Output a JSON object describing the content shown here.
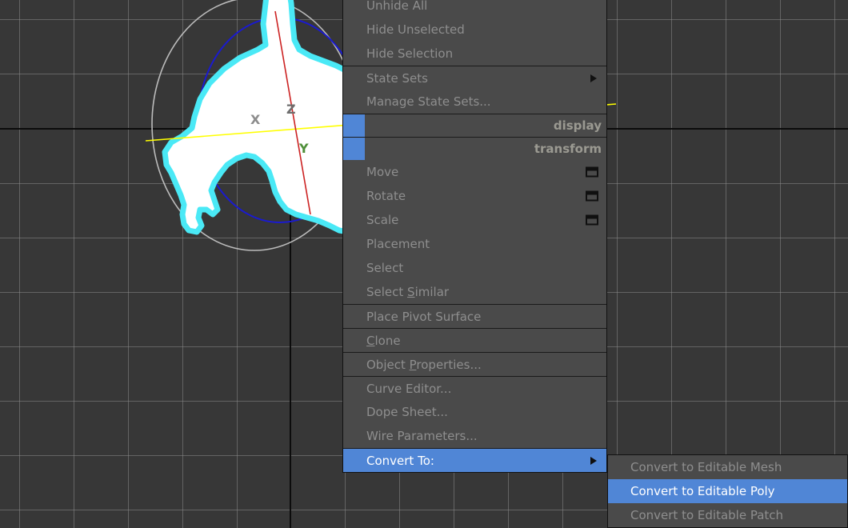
{
  "viewport": {
    "background_color": "#373737",
    "grid_color": "#8a8a8a",
    "axis_color": "#0a0a0a",
    "object": {
      "name": "selected-mesh",
      "fill_color": "#ffffff",
      "outline_color": "#45e8f5"
    },
    "gizmo": {
      "type": "rotate-gizmo",
      "outer_circle_color": "#b9b9b9",
      "inner_circle_color": "#1414c8",
      "axes": [
        {
          "label": "X",
          "color": "#ffff00",
          "label_color": "#8c8c8c"
        },
        {
          "label": "Y",
          "color": "#cc2222",
          "label_color": "#4f8f3a"
        },
        {
          "label": "Z",
          "color": "#cc2222",
          "label_color": "#6a6a6a"
        }
      ]
    }
  },
  "quad_menu": {
    "accent_color": "#5086d6",
    "background_color": "#4a4a4a",
    "text_color": "#8e8e8e",
    "items": [
      {
        "label": "Unhide All",
        "separator": false,
        "arrow": false,
        "settings": false,
        "highlight": false
      },
      {
        "label": "Hide Unselected",
        "separator": false,
        "arrow": false,
        "settings": false,
        "highlight": false
      },
      {
        "label": "Hide Selection",
        "separator": false,
        "arrow": false,
        "settings": false,
        "highlight": false
      },
      {
        "label": "State Sets",
        "separator": true,
        "arrow": true,
        "settings": false,
        "highlight": false
      },
      {
        "label": "Manage State Sets...",
        "separator": false,
        "arrow": false,
        "settings": false,
        "highlight": false
      }
    ],
    "headers": [
      {
        "label": "display"
      },
      {
        "label": "transform"
      }
    ],
    "items2": [
      {
        "label": "Move",
        "separator": false,
        "arrow": false,
        "settings": true,
        "highlight": false
      },
      {
        "label": "Rotate",
        "separator": false,
        "arrow": false,
        "settings": true,
        "highlight": false
      },
      {
        "label": "Scale",
        "separator": false,
        "arrow": false,
        "settings": true,
        "highlight": false
      },
      {
        "label": "Placement",
        "separator": false,
        "arrow": false,
        "settings": false,
        "highlight": false
      },
      {
        "label": "Select",
        "separator": false,
        "arrow": false,
        "settings": false,
        "highlight": false
      },
      {
        "label": "Select Similar",
        "separator": false,
        "arrow": false,
        "settings": false,
        "highlight": false,
        "accel": "S",
        "accel_index": 7
      },
      {
        "label": "Place Pivot Surface",
        "separator": true,
        "arrow": false,
        "settings": false,
        "highlight": false
      },
      {
        "label": "Clone",
        "separator": true,
        "arrow": false,
        "settings": false,
        "highlight": false,
        "accel": "C",
        "accel_index": 0
      },
      {
        "label": "Object Properties...",
        "separator": true,
        "arrow": false,
        "settings": false,
        "highlight": false,
        "accel": "P",
        "accel_index": 7
      },
      {
        "label": "Curve Editor...",
        "separator": true,
        "arrow": false,
        "settings": false,
        "highlight": false
      },
      {
        "label": "Dope Sheet...",
        "separator": false,
        "arrow": false,
        "settings": false,
        "highlight": false
      },
      {
        "label": "Wire Parameters...",
        "separator": false,
        "arrow": false,
        "settings": false,
        "highlight": false
      },
      {
        "label": "Convert To:",
        "separator": true,
        "arrow": true,
        "settings": false,
        "highlight": true
      }
    ]
  },
  "convert_submenu": {
    "items": [
      {
        "label": "Convert to Editable Mesh",
        "highlight": false
      },
      {
        "label": "Convert to Editable Poly",
        "highlight": true
      },
      {
        "label": "Convert to Editable Patch",
        "highlight": false
      }
    ]
  }
}
